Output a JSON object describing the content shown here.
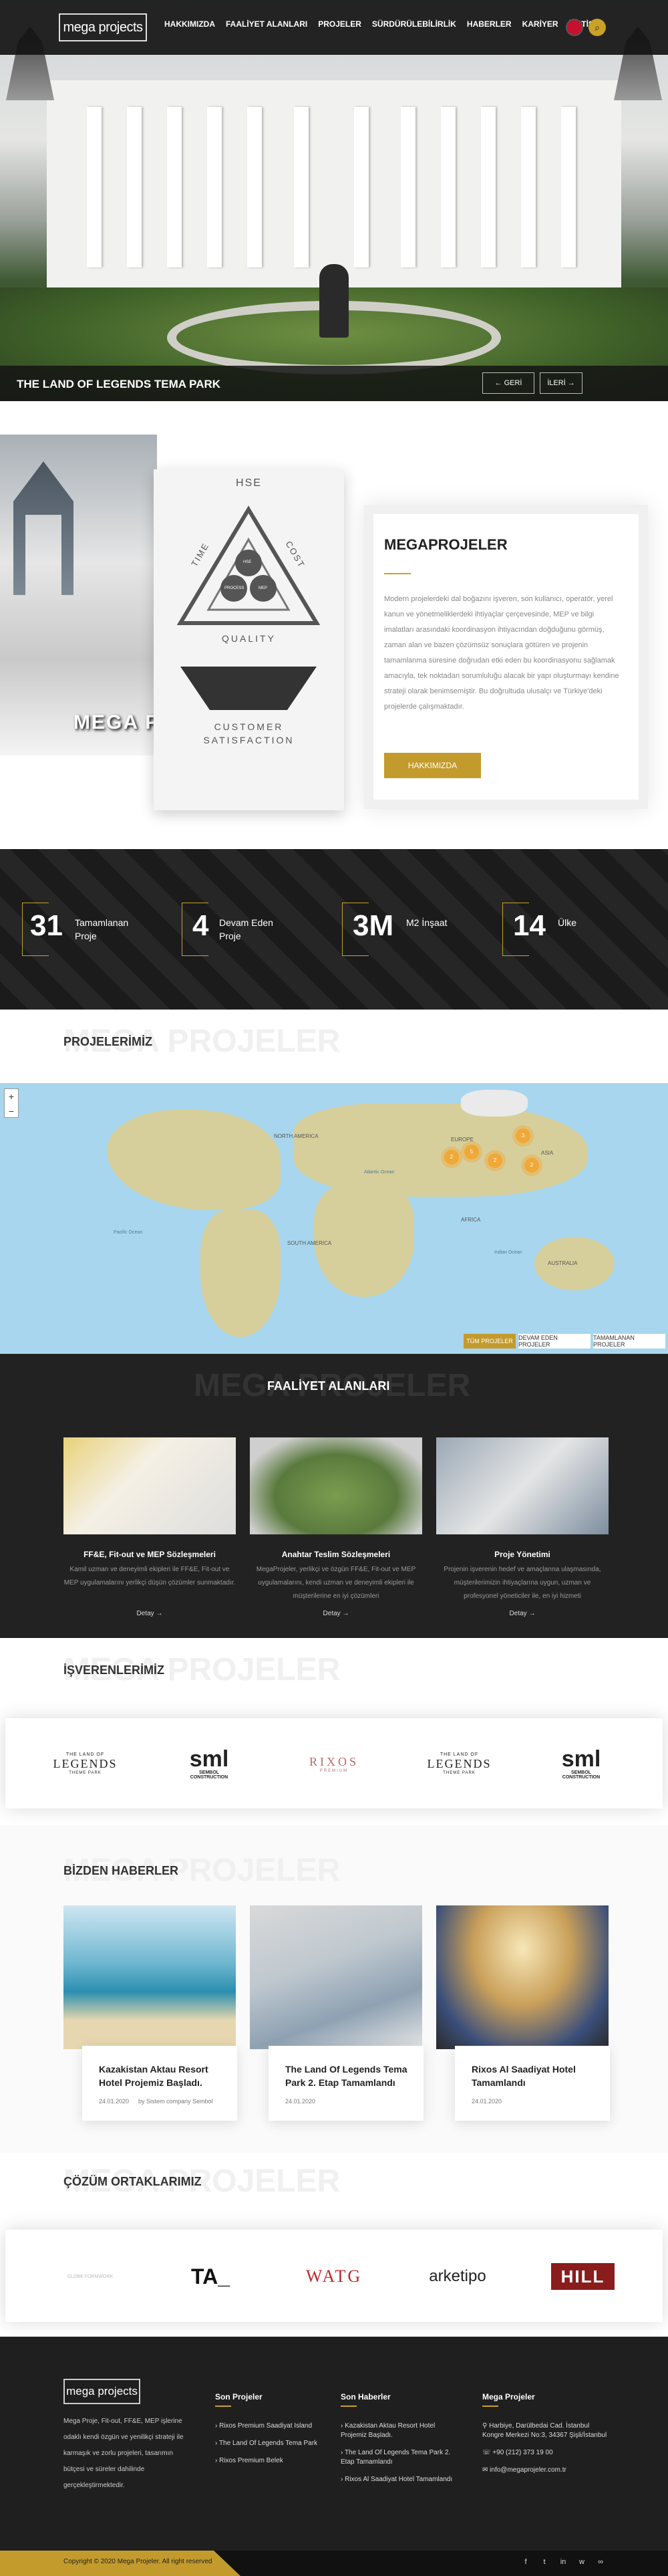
{
  "header": {
    "logo": "mega projects",
    "nav": [
      "HAKKIMIZDA",
      "FAALİYET ALANLARI",
      "PROJELER",
      "SÜRDÜRÜLEBİLİRLİK",
      "HABERLER",
      "KARİYER",
      "İLETİŞİM"
    ]
  },
  "hero": {
    "title": "THE LAND OF LEGENDS TEMA PARK",
    "prev": "←  GERİ",
    "next": "İLERİ →"
  },
  "about": {
    "image_label": "MEGA PROJELER",
    "hse": {
      "top": "HSE",
      "left": "TIME",
      "right": "COST",
      "bottom": "QUALITY",
      "footer": "CUSTOMER SATISFACTION",
      "inner": [
        "HSE",
        "PROCESS",
        "MEP",
        "ENERGY"
      ]
    },
    "title": "MEGAPROJELER",
    "text": "Modern projelerdeki dal boğazını işveren, son kullanıcı, operatör, yerel kanun ve yönetmeliklerdeki ihtiyaçlar çerçevesinde, MEP ve bilgi imalatları arasındaki koordinasyon ihtiyacından doğduğunu görmüş, zaman alan ve bazen çözümsüz sonuçlara götüren ve projenin tamamlanma süresine doğrudan etki eden bu koordinasyonu sağlamak amacıyla, tek noktadan sorumluluğu alacak bir yapı oluşturmayı kendine strateji olarak benimsemiştir. Bu doğrultuda ulusalçı ve Türkiye'deki projelerde çalışmaktadır.",
    "button": "HAKKIMIZDA"
  },
  "stats": [
    {
      "num": "31",
      "label": "Tamamlanan Proje"
    },
    {
      "num": "4",
      "label": "Devam Eden Proje"
    },
    {
      "num": "3M",
      "label": "M2 İnşaat"
    },
    {
      "num": "14",
      "label": "Ülke"
    }
  ],
  "projects": {
    "ghost": "MEGA PROJELER",
    "title": "PROJELERİMİZ",
    "map_labels": [
      "NORTH AMERICA",
      "EUROPE",
      "ASIA",
      "AFRICA",
      "SOUTH AMERICA",
      "AUSTRALIA",
      "Atlantic Ocean",
      "Pacific Ocean",
      "Indian Ocean"
    ],
    "clusters": [
      "3",
      "2",
      "5",
      "2",
      "2"
    ],
    "tabs": [
      "TÜM PROJELER",
      "DEVAM EDEN PROJELER",
      "TAMAMLANAN PROJELER"
    ],
    "zoom_in": "+",
    "zoom_out": "−"
  },
  "services": {
    "ghost": "MEGA PROJELER",
    "title": "FAALİYET ALANLARI",
    "items": [
      {
        "title": "FF&E, Fit-out ve MEP Sözleşmeleri",
        "text": "Kamil uzman ve deneyimli ekipleri ile FF&E, Fit-out ve MEP uygulamalarını yerlikçi düşün çözümler sunmaktadır.",
        "link": "Detay →"
      },
      {
        "title": "Anahtar Teslim Sözleşmeleri",
        "text": "MegaProjeler, yerlikçi ve özgün FF&E, Fit-out ve MEP uygulamalarını, kendi uzman ve deneyimli ekipleri ile müşterilerine en iyi çözümleri",
        "link": "Detay →"
      },
      {
        "title": "Proje Yönetimi",
        "text": "Projenin işverenin hedef ve amaçlarına ulaşmasında, müşterilerimizin ihtiyaçlarına uygun, uzman ve profesyonel yöneticiler ile, en iyi hizmeti",
        "link": "Detay →"
      }
    ]
  },
  "employers": {
    "ghost": "MEGA PROJELER",
    "title": "İŞVERENLERİMİZ",
    "logos": [
      {
        "top": "THE LAND OF",
        "main": "LEGENDS",
        "sub": "THEME PARK"
      },
      {
        "top": "",
        "main": "sml",
        "sub": "SEMBOL CONSTRUCTION"
      },
      {
        "top": "",
        "main": "RIXOS",
        "sub": "PREMIUM"
      },
      {
        "top": "THE LAND OF",
        "main": "LEGENDS",
        "sub": "THEME PARK"
      },
      {
        "top": "",
        "main": "sml",
        "sub": "SEMBOL CONSTRUCTION"
      }
    ]
  },
  "news": {
    "ghost": "MEGA PROJELER",
    "title": "BİZDEN HABERLER",
    "items": [
      {
        "title": "Kazakistan Aktau Resort Hotel Projemiz Başladı.",
        "date": "24.01.2020",
        "author": "by Sistem company Sembol"
      },
      {
        "title": "The Land Of Legends Tema Park 2. Etap Tamamlandı",
        "date": "24.01.2020",
        "author": ""
      },
      {
        "title": "Rixos Al Saadiyat Hotel Tamamlandı",
        "date": "24.01.2020",
        "author": ""
      }
    ]
  },
  "partners": {
    "ghost": "MEGA PROJELER",
    "title": "ÇÖZÜM ORTAKLARIMIZ",
    "logos": [
      "GLOBE FORMWORK",
      "TA_",
      "WATG",
      "arketipo",
      "HILL"
    ]
  },
  "footer": {
    "logo": "mega projects",
    "desc": "Mega Proje, Fit-out, FF&E, MEP işlerine odaklı kendi özgün ve yenilikçi strateji ile karmaşık ve zorlu projeleri, tasarımın bütçesi ve süreler dahilinde gerçekleştirmektedir.",
    "cols": [
      {
        "head": "Son Projeler",
        "items": [
          "Rixos Premium Saadiyat Island",
          "The Land Of Legends Tema Park",
          "Rixos Premium Belek"
        ]
      },
      {
        "head": "Son Haberler",
        "items": [
          "Kazakistan Aktau Resort Hotel Projemiz Başladı.",
          "The Land Of Legends Tema Park 2. Etap Tamamlandı",
          "Rixos Al Saadiyat Hotel Tamamlandı"
        ]
      },
      {
        "head": "Mega Projeler",
        "items": [
          "Harbiye, Darülbedai Cad. İstanbul Kongre Merkezi No:3, 34367 Şişli/İstanbul",
          "+90 (212) 373 19 00",
          "info@megaprojeler.com.tr"
        ]
      }
    ],
    "copyright": "Copyright © 2020 Mega Projeler. All right reserved",
    "social": [
      "f",
      "t",
      "in",
      "w",
      "∞"
    ]
  },
  "colors": {
    "gold": "#c39b2d",
    "dark": "#222222"
  }
}
